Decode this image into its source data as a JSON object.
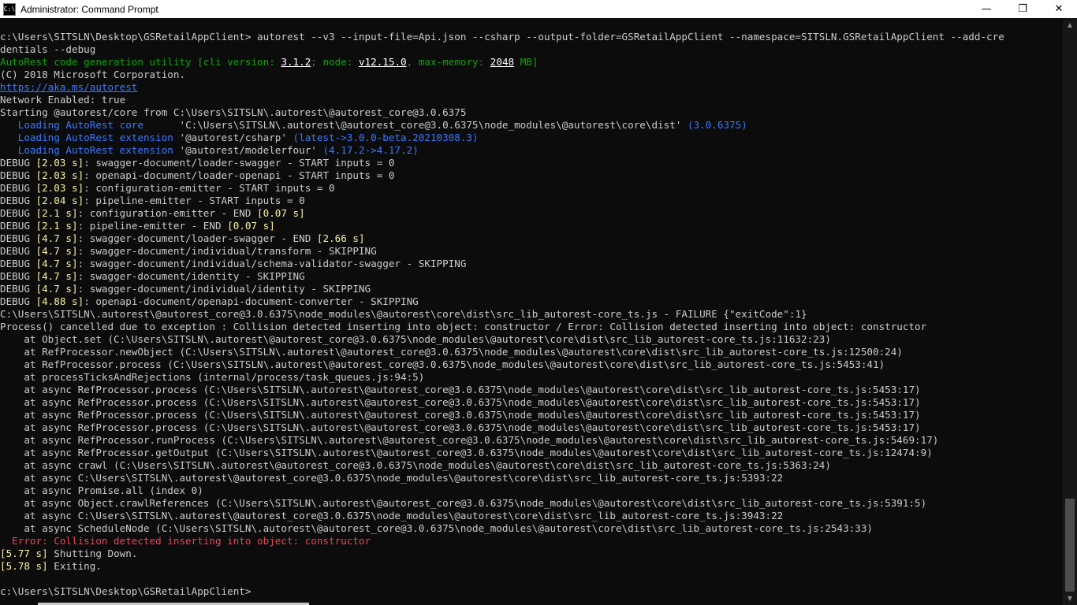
{
  "window": {
    "title": "Administrator: Command Prompt",
    "icon_text": "C:\\",
    "controls": {
      "minimize": "—",
      "maximize": "❐",
      "close": "✕"
    }
  },
  "console": {
    "command": "c:\\Users\\SITSLN\\Desktop\\GSRetailAppClient> autorest --v3 --input-file=Api.json --csharp --output-folder=GSRetailAppClient --namespace=SITSLN.GSRetailAppClient --add-cre",
    "command_cont": "dentials --debug",
    "banner": {
      "name": "AutoRest code generation utility",
      "cli_open": " [cli version: ",
      "cli_version": "3.1.2",
      "node_label": "; node: ",
      "node_version": "v12.15.0",
      "mem_label": ", max-memory: ",
      "mem_value": "2048",
      "mem_unit": " MB]"
    },
    "copyright": "(C) 2018 Microsoft Corporation.",
    "link": "https://aka.ms/autorest",
    "network": "Network Enabled: true",
    "starting": "Starting @autorest/core from C:\\Users\\SITSLN\\.autorest\\@autorest_core@3.0.6375",
    "loading": [
      {
        "prefix": "   Loading ",
        "name": "AutoRest core",
        "pad": "      ",
        "path": "'C:\\Users\\SITSLN\\.autorest\\@autorest_core@3.0.6375\\node_modules\\@autorest\\core\\dist'",
        "ver": " (3.0.6375)"
      },
      {
        "prefix": "   Loading ",
        "name": "AutoRest extension",
        "pad": " ",
        "path": "'@autorest/csharp'",
        "ver": " (latest->3.0.0-beta.20210308.3)"
      },
      {
        "prefix": "   Loading ",
        "name": "AutoRest extension",
        "pad": " ",
        "path": "'@autorest/modelerfour'",
        "ver": " (4.17.2->4.17.2)"
      }
    ],
    "debug": [
      {
        "t": "[2.03 s]",
        "msg": ": swagger-document/loader-swagger - START inputs = 0",
        "end": ""
      },
      {
        "t": "[2.03 s]",
        "msg": ": openapi-document/loader-openapi - START inputs = 0",
        "end": ""
      },
      {
        "t": "[2.03 s]",
        "msg": ": configuration-emitter - START inputs = 0",
        "end": ""
      },
      {
        "t": "[2.04 s]",
        "msg": ": pipeline-emitter - START inputs = 0",
        "end": ""
      },
      {
        "t": "[2.1 s]",
        "msg": ": configuration-emitter - END ",
        "end": "[0.07 s]"
      },
      {
        "t": "[2.1 s]",
        "msg": ": pipeline-emitter - END ",
        "end": "[0.07 s]"
      },
      {
        "t": "[4.7 s]",
        "msg": ": swagger-document/loader-swagger - END ",
        "end": "[2.66 s]"
      },
      {
        "t": "[4.7 s]",
        "msg": ": swagger-document/individual/transform - SKIPPING",
        "end": ""
      },
      {
        "t": "[4.7 s]",
        "msg": ": swagger-document/individual/schema-validator-swagger - SKIPPING",
        "end": ""
      },
      {
        "t": "[4.7 s]",
        "msg": ": swagger-document/identity - SKIPPING",
        "end": ""
      },
      {
        "t": "[4.7 s]",
        "msg": ": swagger-document/individual/identity - SKIPPING",
        "end": ""
      },
      {
        "t": "[4.88 s]",
        "msg": ": openapi-document/openapi-document-converter - SKIPPING",
        "end": ""
      }
    ],
    "failure": "C:\\Users\\SITSLN\\.autorest\\@autorest_core@3.0.6375\\node_modules\\@autorest\\core\\dist\\src_lib_autorest-core_ts.js - FAILURE {\"exitCode\":1}",
    "process_cancel": "Process() cancelled due to exception : Collision detected inserting into object: constructor / Error: Collision detected inserting into object: constructor",
    "stack": [
      "    at Object.set (C:\\Users\\SITSLN\\.autorest\\@autorest_core@3.0.6375\\node_modules\\@autorest\\core\\dist\\src_lib_autorest-core_ts.js:11632:23)",
      "    at RefProcessor.newObject (C:\\Users\\SITSLN\\.autorest\\@autorest_core@3.0.6375\\node_modules\\@autorest\\core\\dist\\src_lib_autorest-core_ts.js:12500:24)",
      "    at RefProcessor.process (C:\\Users\\SITSLN\\.autorest\\@autorest_core@3.0.6375\\node_modules\\@autorest\\core\\dist\\src_lib_autorest-core_ts.js:5453:41)",
      "    at processTicksAndRejections (internal/process/task_queues.js:94:5)",
      "    at async RefProcessor.process (C:\\Users\\SITSLN\\.autorest\\@autorest_core@3.0.6375\\node_modules\\@autorest\\core\\dist\\src_lib_autorest-core_ts.js:5453:17)",
      "    at async RefProcessor.process (C:\\Users\\SITSLN\\.autorest\\@autorest_core@3.0.6375\\node_modules\\@autorest\\core\\dist\\src_lib_autorest-core_ts.js:5453:17)",
      "    at async RefProcessor.process (C:\\Users\\SITSLN\\.autorest\\@autorest_core@3.0.6375\\node_modules\\@autorest\\core\\dist\\src_lib_autorest-core_ts.js:5453:17)",
      "    at async RefProcessor.process (C:\\Users\\SITSLN\\.autorest\\@autorest_core@3.0.6375\\node_modules\\@autorest\\core\\dist\\src_lib_autorest-core_ts.js:5453:17)",
      "    at async RefProcessor.runProcess (C:\\Users\\SITSLN\\.autorest\\@autorest_core@3.0.6375\\node_modules\\@autorest\\core\\dist\\src_lib_autorest-core_ts.js:5469:17)",
      "    at async RefProcessor.getOutput (C:\\Users\\SITSLN\\.autorest\\@autorest_core@3.0.6375\\node_modules\\@autorest\\core\\dist\\src_lib_autorest-core_ts.js:12474:9)",
      "    at async crawl (C:\\Users\\SITSLN\\.autorest\\@autorest_core@3.0.6375\\node_modules\\@autorest\\core\\dist\\src_lib_autorest-core_ts.js:5363:24)",
      "    at async C:\\Users\\SITSLN\\.autorest\\@autorest_core@3.0.6375\\node_modules\\@autorest\\core\\dist\\src_lib_autorest-core_ts.js:5393:22",
      "    at async Promise.all (index 0)",
      "    at async Object.crawlReferences (C:\\Users\\SITSLN\\.autorest\\@autorest_core@3.0.6375\\node_modules\\@autorest\\core\\dist\\src_lib_autorest-core_ts.js:5391:5)",
      "    at async C:\\Users\\SITSLN\\.autorest\\@autorest_core@3.0.6375\\node_modules\\@autorest\\core\\dist\\src_lib_autorest-core_ts.js:3943:22",
      "    at async ScheduleNode (C:\\Users\\SITSLN\\.autorest\\@autorest_core@3.0.6375\\node_modules\\@autorest\\core\\dist\\src_lib_autorest-core_ts.js:2543:33)"
    ],
    "error": "  Error: Collision detected inserting into object: constructor",
    "shutdown": [
      {
        "t": "[5.77 s]",
        "msg": " Shutting Down."
      },
      {
        "t": "[5.78 s]",
        "msg": " Exiting."
      }
    ],
    "prompt": "c:\\Users\\SITSLN\\Desktop\\GSRetailAppClient>"
  },
  "colors": {
    "background": "#0c0c0c",
    "text": "#cccccc",
    "green": "#13a10e",
    "yellow": "#f9f1a5",
    "blue": "#3b78ff",
    "cyan": "#61d6d6",
    "red": "#e74856"
  }
}
